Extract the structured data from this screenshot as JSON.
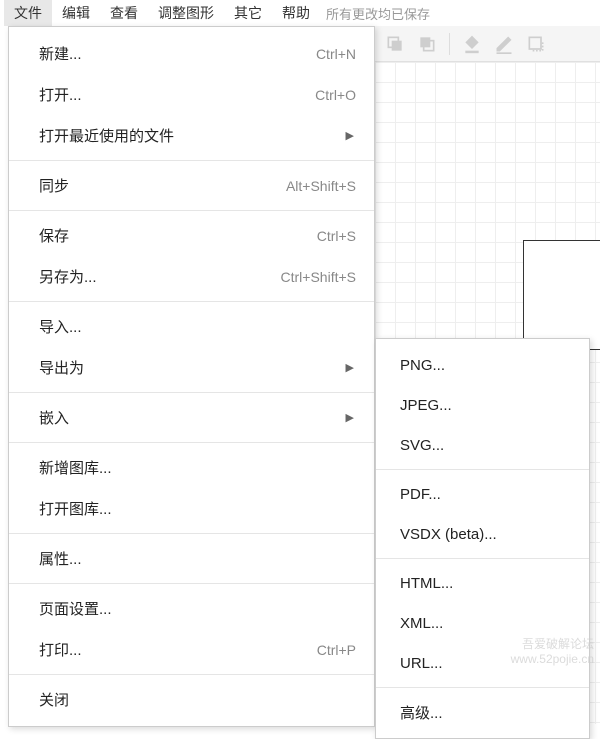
{
  "menubar": {
    "items": [
      "文件",
      "编辑",
      "查看",
      "调整图形",
      "其它",
      "帮助"
    ],
    "status": "所有更改均已保存"
  },
  "fileMenu": {
    "groups": [
      [
        {
          "label": "新建...",
          "shortcut": "Ctrl+N"
        },
        {
          "label": "打开...",
          "shortcut": "Ctrl+O"
        },
        {
          "label": "打开最近使用的文件",
          "submenu": true
        }
      ],
      [
        {
          "label": "同步",
          "shortcut": "Alt+Shift+S"
        }
      ],
      [
        {
          "label": "保存",
          "shortcut": "Ctrl+S"
        },
        {
          "label": "另存为...",
          "shortcut": "Ctrl+Shift+S"
        }
      ],
      [
        {
          "label": "导入..."
        },
        {
          "label": "导出为",
          "submenu": true
        }
      ],
      [
        {
          "label": "嵌入",
          "submenu": true
        }
      ],
      [
        {
          "label": "新增图库..."
        },
        {
          "label": "打开图库..."
        }
      ],
      [
        {
          "label": "属性..."
        }
      ],
      [
        {
          "label": "页面设置..."
        },
        {
          "label": "打印...",
          "shortcut": "Ctrl+P"
        }
      ],
      [
        {
          "label": "关闭"
        }
      ]
    ]
  },
  "exportSubmenu": {
    "groups": [
      [
        "PNG...",
        "JPEG...",
        "SVG..."
      ],
      [
        "PDF...",
        "VSDX (beta)..."
      ],
      [
        "HTML...",
        "XML...",
        "URL..."
      ],
      [
        "高级..."
      ]
    ]
  },
  "watermark": {
    "line1": "吾爱破解论坛",
    "line2": "www.52pojie.cn"
  }
}
